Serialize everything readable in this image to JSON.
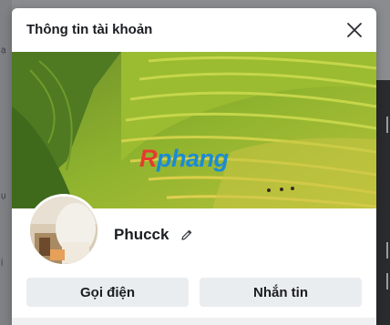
{
  "background": {
    "left_fragments": [
      "ạ",
      "ụ",
      "ị"
    ]
  },
  "modal": {
    "title": "Thông tin tài khoản",
    "close_icon": "close-icon",
    "cover_watermark": {
      "first_letter": "R",
      "rest": "phang"
    },
    "profile": {
      "name": "Phucck",
      "edit_icon": "pencil-icon"
    },
    "actions": {
      "call_label": "Gọi điện",
      "message_label": "Nhắn tin"
    }
  },
  "colors": {
    "title_text": "#1a1d21",
    "button_bg": "#eaedf0",
    "watermark_red": "#e63a2f",
    "watermark_blue": "#1b8bd6"
  }
}
